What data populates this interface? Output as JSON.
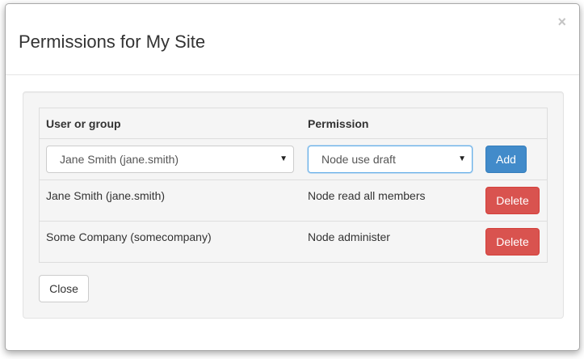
{
  "dialog": {
    "title": "Permissions for My Site",
    "close_glyph": "×"
  },
  "table": {
    "headers": {
      "user_or_group": "User or group",
      "permission": "Permission"
    },
    "new_entry": {
      "user_select_value": "Jane Smith (jane.smith)",
      "permission_select_value": "Node use draft",
      "caret_glyph": "▼",
      "add_label": "Add"
    },
    "rows": [
      {
        "user": "Jane Smith (jane.smith)",
        "permission": "Node read all members",
        "delete_label": "Delete"
      },
      {
        "user": "Some Company (somecompany)",
        "permission": "Node administer",
        "delete_label": "Delete"
      }
    ]
  },
  "footer": {
    "close_label": "Close"
  },
  "colors": {
    "primary": "#428bca",
    "danger": "#d9534f",
    "well_background": "#f5f5f5"
  }
}
